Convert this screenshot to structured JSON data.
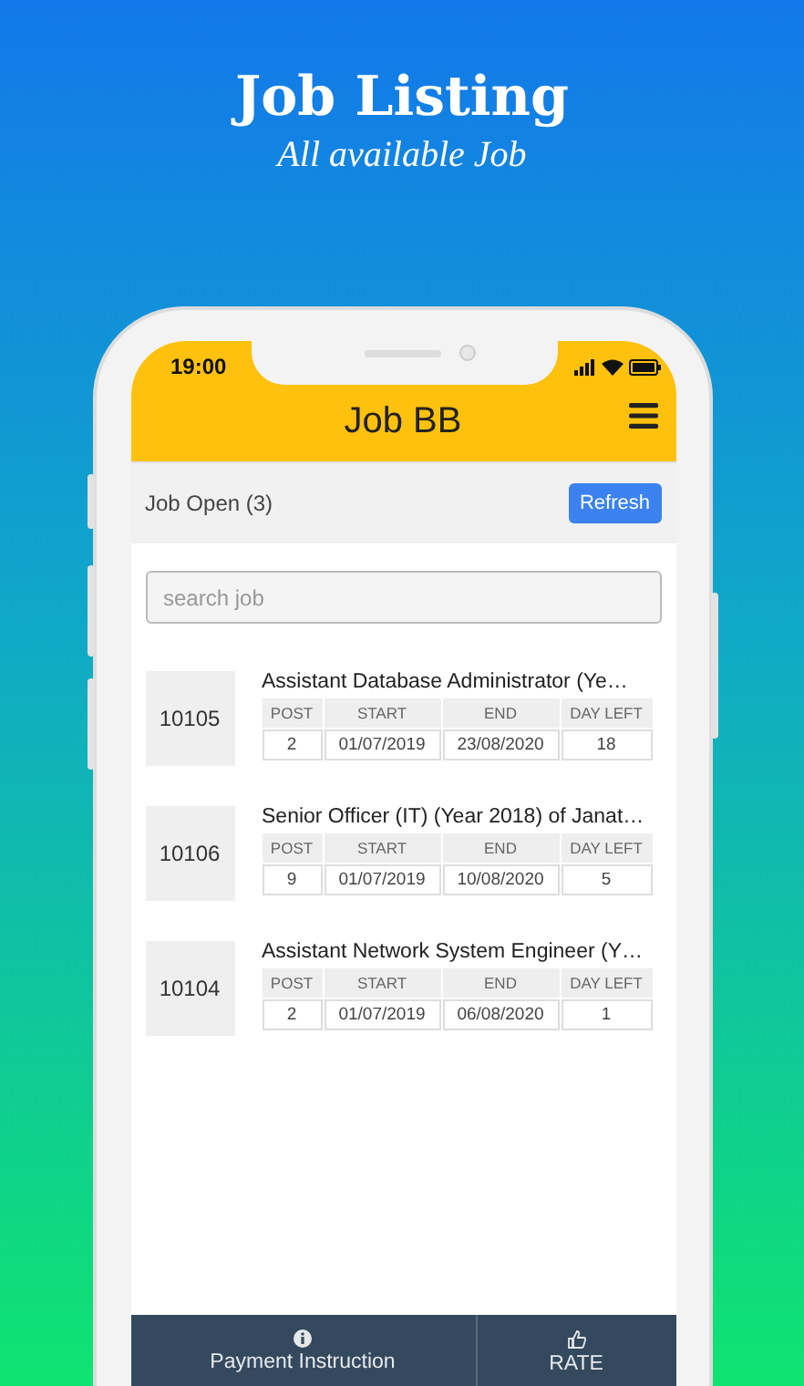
{
  "banner": {
    "title": "Job Listing",
    "subtitle": "All available Job"
  },
  "status_bar": {
    "time": "19:00"
  },
  "app_bar": {
    "title": "Job BB"
  },
  "subheader": {
    "label": "Job Open (3)",
    "button": "Refresh"
  },
  "search": {
    "placeholder": "search job"
  },
  "jobs": [
    {
      "columns": [
        "POST",
        "START",
        "END",
        "DAY LEFT"
      ],
      "id": "10105",
      "title": "Assistant Database Administrator (Ye…",
      "post": "2",
      "start": "01/07/2019",
      "end": "23/08/2020",
      "day_left": "18"
    },
    {
      "columns": [
        "POST",
        "START",
        "END",
        "DAY LEFT"
      ],
      "id": "10106",
      "title": "Senior Officer (IT) (Year 2018) of Janat…",
      "post": "9",
      "start": "01/07/2019",
      "end": "10/08/2020",
      "day_left": "5"
    },
    {
      "columns": [
        "POST",
        "START",
        "END",
        "DAY LEFT"
      ],
      "id": "10104",
      "title": "Assistant Network System Engineer (Y…",
      "post": "2",
      "start": "01/07/2019",
      "end": "06/08/2020",
      "day_left": "1"
    }
  ],
  "bottom_nav": [
    {
      "label": "Payment Instruction",
      "kind": "info"
    },
    {
      "label": "RATE",
      "kind": "thumb"
    }
  ]
}
